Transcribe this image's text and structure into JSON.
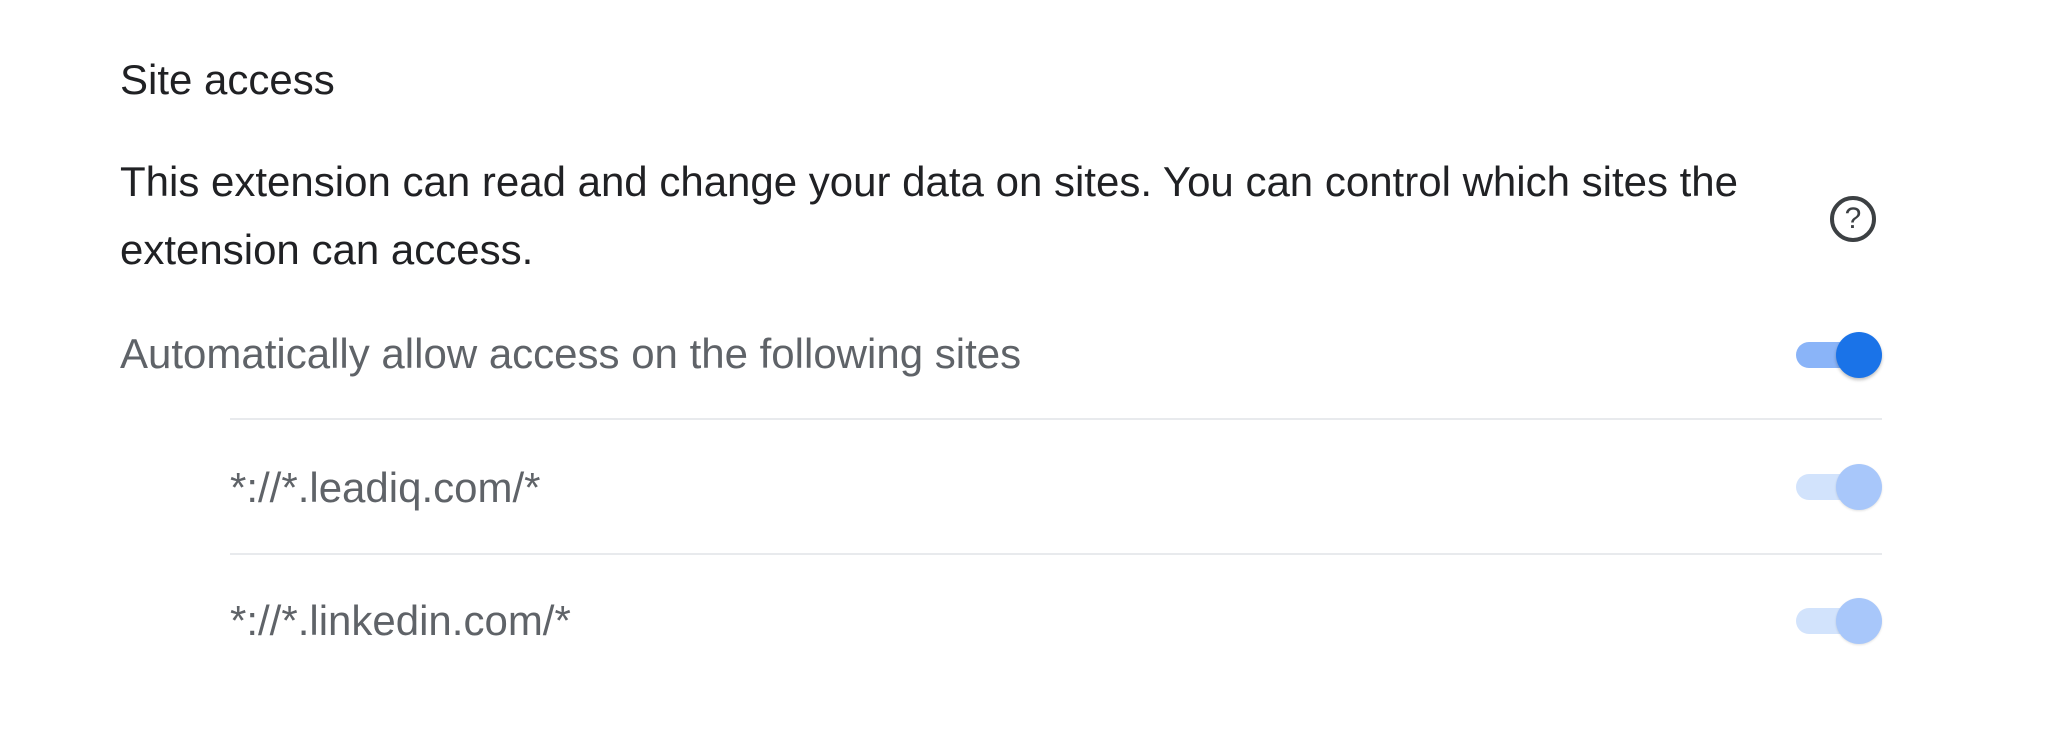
{
  "site_access": {
    "title": "Site access",
    "description": "This extension can read and change your data on sites. You can control which sites the extension can access.",
    "help_icon": "help-circle-icon",
    "auto_allow": {
      "label": "Automatically allow access on the following sites",
      "enabled": true
    },
    "sites": [
      {
        "pattern": "*://*.leadiq.com/*",
        "enabled": true,
        "disabled_control": true
      },
      {
        "pattern": "*://*.linkedin.com/*",
        "enabled": true,
        "disabled_control": true
      }
    ]
  },
  "colors": {
    "toggle_on_knob": "#1a73e8",
    "toggle_on_track": "#8ab4f8",
    "toggle_disabled_knob": "#a8c7fa",
    "toggle_disabled_track": "#d2e3fc",
    "divider": "#e8eaed"
  }
}
